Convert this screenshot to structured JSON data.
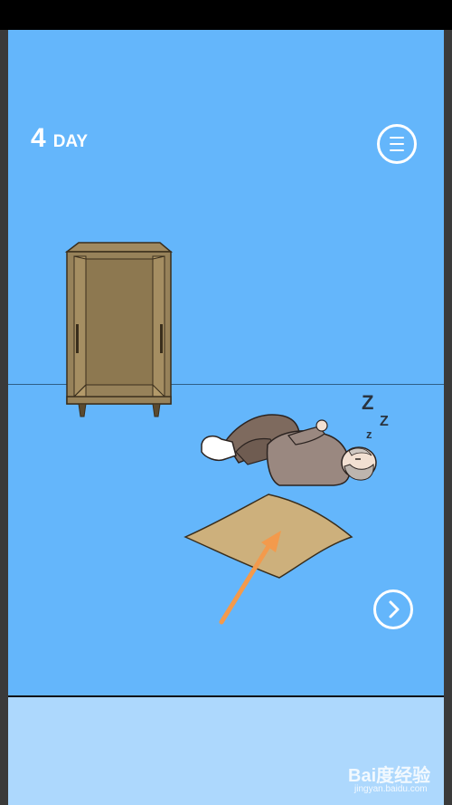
{
  "hud": {
    "day_number": "4",
    "day_label": "DAY"
  },
  "scene": {
    "snore_large": "Z",
    "snore_medium": "Z",
    "snore_small": "z"
  },
  "watermark": {
    "text": "Bai度经验",
    "sub": "jingyan.baidu.com"
  },
  "colors": {
    "sky": "#64b6fb",
    "bottom_panel": "#add8fd",
    "cabinet": "#97825a",
    "rug": "#cdb07c",
    "arrow": "#f39a4c",
    "sweater": "#9a8880",
    "pants": "#7e6a5e"
  },
  "icons": [
    "menu-icon",
    "next-arrow-icon",
    "hint-arrow-icon"
  ]
}
